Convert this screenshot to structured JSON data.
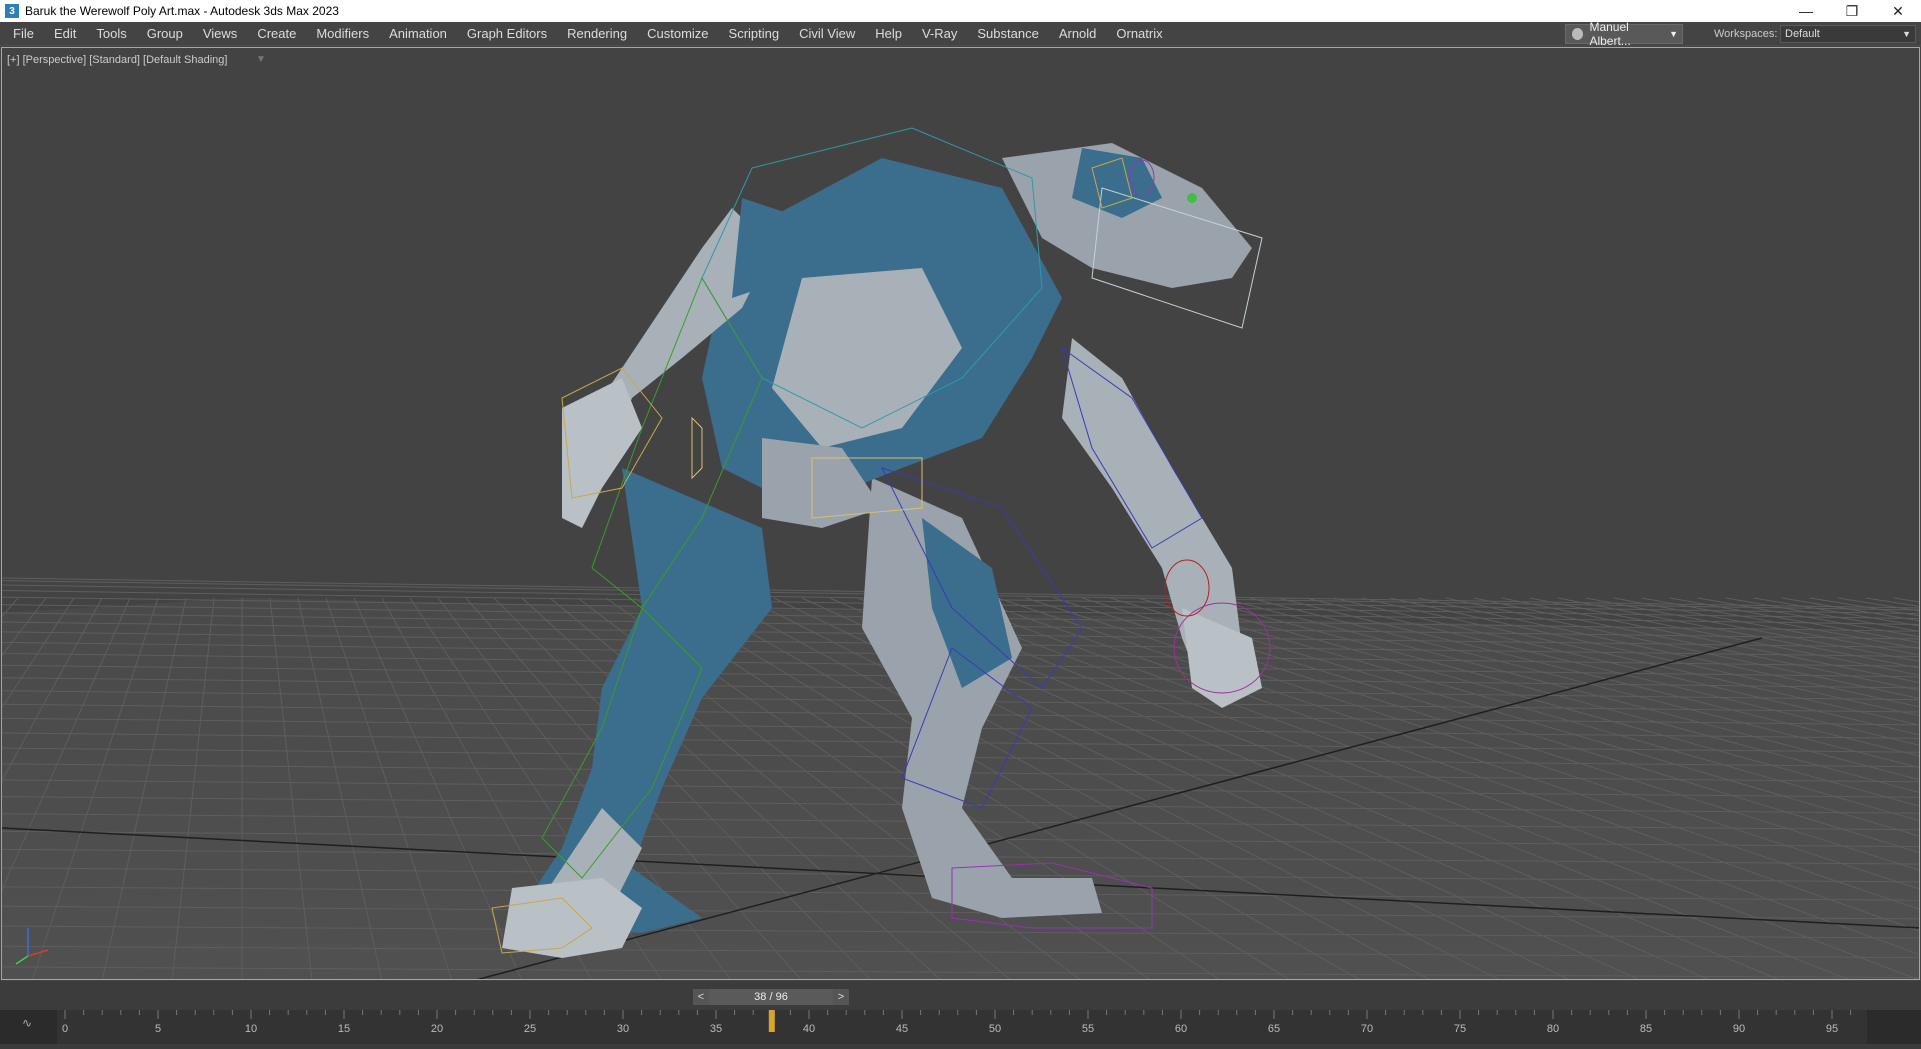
{
  "window": {
    "title": "Baruk the Werewolf Poly Art.max - Autodesk 3ds Max 2023",
    "app_icon_glyph": "3",
    "controls": [
      "minimize-icon",
      "restore-icon",
      "close-icon"
    ]
  },
  "menu": {
    "items": [
      "File",
      "Edit",
      "Tools",
      "Group",
      "Views",
      "Create",
      "Modifiers",
      "Animation",
      "Graph Editors",
      "Rendering",
      "Customize",
      "Scripting",
      "Civil View",
      "Help",
      "V-Ray",
      "Substance",
      "Arnold",
      "Ornatrix"
    ],
    "user": "Manuel Albert...",
    "workspaces_label": "Workspaces:",
    "workspace": "Default"
  },
  "viewport": {
    "label": "[+] [Perspective] [Standard] [Default Shading]",
    "filter_icon": "filter-icon"
  },
  "timeline": {
    "prev": "<",
    "next": ">",
    "frame_display": "38 / 96",
    "current_frame": 38,
    "total_frames": 96,
    "tick_labels": [
      "0",
      "5",
      "10",
      "15",
      "20",
      "25",
      "30",
      "35",
      "40",
      "45",
      "50",
      "55",
      "60",
      "65",
      "70",
      "75",
      "80",
      "85",
      "90",
      "95"
    ],
    "curve_icon": "curve-editor-icon"
  },
  "colors": {
    "viewport_bg": "#434343",
    "grid": "#5a5a5a",
    "accent": "#d4a531",
    "character_blue": "#3a6e8c",
    "character_gray": "#a9b1b8"
  }
}
